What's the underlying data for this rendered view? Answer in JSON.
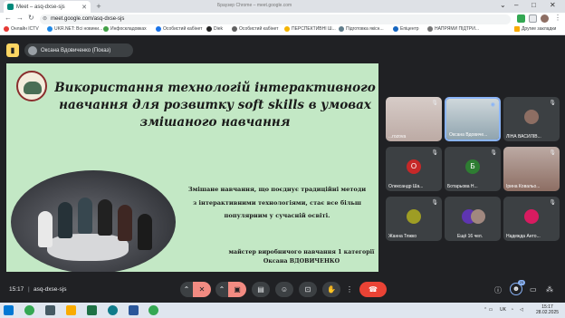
{
  "browser": {
    "tab_title": "Meet – asq-dxse-sjs",
    "window_title": "Браузер Chrome – meet.google.com",
    "url": "meet.google.com/asq-dxse-sjs",
    "bookmarks": [
      {
        "label": "Онлайн ICTV",
        "color": "#e53935"
      },
      {
        "label": "UKR.NET: Всі новини...",
        "color": "#1e88e5"
      },
      {
        "label": "Инфоскладовках",
        "color": "#43a047"
      },
      {
        "label": "Особистий кабінет",
        "color": "#1a73e8"
      },
      {
        "label": "Diek",
        "color": "#222222"
      },
      {
        "label": "Особистий кабінет",
        "color": "#616161"
      },
      {
        "label": "ПЕРСПЕКТИВНІ Ш...",
        "color": "#f4b400"
      },
      {
        "label": "Підготовка якісн...",
        "color": "#607d8b"
      },
      {
        "label": "Епіцентр",
        "color": "#1565c0"
      },
      {
        "label": "НАПРЯМИ ПІДТРИ...",
        "color": "#757575"
      }
    ],
    "other_bookmarks": "Другие закладки"
  },
  "meet": {
    "presenter_label": "Оксана Вдовиченко (Показ)",
    "slide": {
      "title": "Використання технологій інтерактивного навчання для розвитку soft skills в умовах змішаного навчання",
      "body": "Змішане навчання, що поєднує традиційні методи з інтерактивними технологіями, стає все більш популярним у сучасній освіті.",
      "author_role": "майстер виробничого навчання 1 категорії",
      "author_name": "Оксана ВДОВИЧЕНКО"
    },
    "participants": [
      {
        "name": "...rozova",
        "type": "video",
        "color": "#c9b9a6"
      },
      {
        "name": "Оксана Вдовиче...",
        "type": "video",
        "color": "#b7c1c9",
        "active": true
      },
      {
        "name": "ЛІНА ВАСИЛІВ...",
        "type": "photo",
        "color": "#8d6e63"
      },
      {
        "name": "Олександр Ша...",
        "type": "letter",
        "letter": "О",
        "color": "#c62828"
      },
      {
        "name": "Ботарьова Н...",
        "type": "letter",
        "letter": "Б",
        "color": "#2e7d32"
      },
      {
        "name": "Ірина Ковальо...",
        "type": "video",
        "color": "#a1887f"
      },
      {
        "name": "Жанна Тяжко",
        "type": "photo",
        "color": "#9e9d24"
      },
      {
        "name": "Ещё 16 чел.",
        "type": "more",
        "color": "#5e35b1"
      },
      {
        "name": "Надежда Анто...",
        "type": "photo",
        "color": "#d81b60"
      }
    ],
    "time": "15:17",
    "meeting_code": "asq-dxse-sjs",
    "participant_count": "25"
  },
  "taskbar": {
    "lang": "UK",
    "time": "15:17",
    "date": "28.02.2025"
  }
}
